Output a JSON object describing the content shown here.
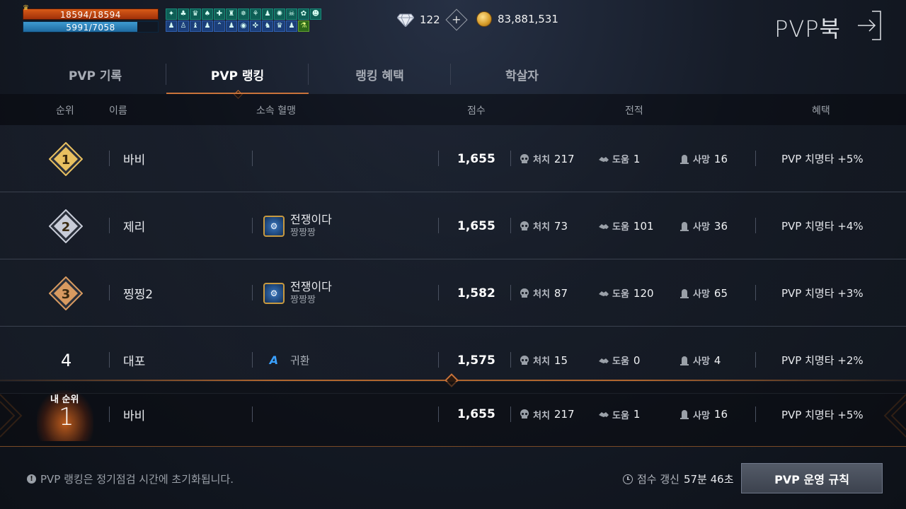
{
  "hud": {
    "hp": "18594/18594",
    "mp": "5991/7058",
    "mp_fraction": 0.849
  },
  "buffs": {
    "row1": [
      "✦",
      "♣",
      "♛",
      "♠",
      "✚",
      "♜",
      "✵",
      "⚘",
      "♟",
      "✺",
      "☠",
      "✿",
      "☻"
    ],
    "row2": [
      "♟",
      "♙",
      "♝",
      "♟",
      "⌃",
      "♟",
      "◉",
      "✜",
      "♞",
      "♛",
      "♟",
      "⚗"
    ]
  },
  "currency": {
    "diamond": "122",
    "gold": "83,881,531"
  },
  "title": "PVP북",
  "tabs": [
    "PVP 기록",
    "PVP 랭킹",
    "랭킹 혜택",
    "학살자"
  ],
  "active_tab": 1,
  "columns": {
    "rank": "순위",
    "name": "이름",
    "clan": "소속 혈맹",
    "score": "점수",
    "record": "전적",
    "benefit": "혜택"
  },
  "stat_labels": {
    "kill": "처치",
    "assist": "도움",
    "death": "사망"
  },
  "rows": [
    {
      "rank": "1",
      "name": "바비",
      "clan": "",
      "clan_sub": "",
      "score": "1,655",
      "kill": "217",
      "assist": "1",
      "death": "16",
      "benefit": "PVP 치명타 +5%"
    },
    {
      "rank": "2",
      "name": "제리",
      "clan": "전쟁이다",
      "clan_sub": "짱짱짱",
      "score": "1,655",
      "kill": "73",
      "assist": "101",
      "death": "36",
      "benefit": "PVP 치명타 +4%"
    },
    {
      "rank": "3",
      "name": "찡찡2",
      "clan": "전쟁이다",
      "clan_sub": "짱짱짱",
      "score": "1,582",
      "kill": "87",
      "assist": "120",
      "death": "65",
      "benefit": "PVP 치명타 +3%"
    },
    {
      "rank": "4",
      "name": "대포",
      "clan": "귀환",
      "clan_sub": "",
      "score": "1,575",
      "kill": "15",
      "assist": "0",
      "death": "4",
      "benefit": "PVP 치명타 +2%"
    }
  ],
  "my_rank": {
    "label": "내 순위",
    "rank": "1",
    "name": "바비",
    "score": "1,655",
    "kill": "217",
    "assist": "1",
    "death": "16",
    "benefit": "PVP 치명타 +5%"
  },
  "footer": {
    "notice": "PVP 랭킹은 정기점검 시간에 초기화됩니다.",
    "refresh_label": "점수 갱신",
    "refresh_time": "57분 46초",
    "rules_button": "PVP 운영 규칙"
  },
  "colors": {
    "accent": "#c9733a",
    "gold_badge": "#e8c060",
    "silver_badge": "#c8ccd8",
    "bronze_badge": "#d89a60"
  }
}
